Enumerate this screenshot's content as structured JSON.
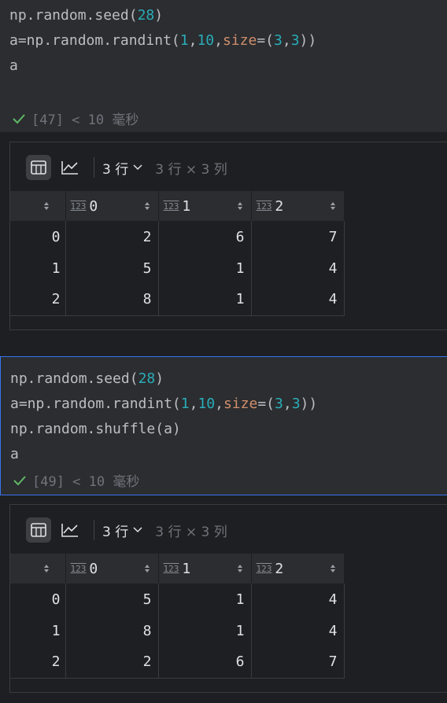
{
  "cell1": {
    "lines": [
      [
        {
          "t": "np.random.seed("
        },
        {
          "t": "28",
          "c": "num"
        },
        {
          "t": ")"
        }
      ],
      [
        {
          "t": "a=np.random.randint("
        },
        {
          "t": "1",
          "c": "num"
        },
        {
          "t": ","
        },
        {
          "t": "10",
          "c": "num"
        },
        {
          "t": ","
        },
        {
          "t": "size",
          "c": "kw"
        },
        {
          "t": "=("
        },
        {
          "t": "3",
          "c": "num"
        },
        {
          "t": ","
        },
        {
          "t": "3",
          "c": "num"
        },
        {
          "t": "))"
        }
      ],
      [
        {
          "t": "a"
        }
      ]
    ],
    "status": "[47] < 10 毫秒"
  },
  "output1": {
    "rows_label": "3 行",
    "shape_label": "3 行 × 3 列",
    "columns": [
      {
        "type": "123",
        "name": "0"
      },
      {
        "type": "123",
        "name": "1"
      },
      {
        "type": "123",
        "name": "2"
      }
    ],
    "rows": [
      [
        "0",
        "2",
        "6",
        "7"
      ],
      [
        "1",
        "5",
        "1",
        "4"
      ],
      [
        "2",
        "8",
        "1",
        "4"
      ]
    ]
  },
  "cell2": {
    "lines": [
      [
        {
          "t": "np.random.seed("
        },
        {
          "t": "28",
          "c": "num"
        },
        {
          "t": ")"
        }
      ],
      [
        {
          "t": "a=np.random.randint("
        },
        {
          "t": "1",
          "c": "num"
        },
        {
          "t": ","
        },
        {
          "t": "10",
          "c": "num"
        },
        {
          "t": ","
        },
        {
          "t": "size",
          "c": "kw"
        },
        {
          "t": "=("
        },
        {
          "t": "3",
          "c": "num"
        },
        {
          "t": ","
        },
        {
          "t": "3",
          "c": "num"
        },
        {
          "t": "))"
        }
      ],
      [
        {
          "t": "np.random.shuffle(a)"
        }
      ],
      [
        {
          "t": "a"
        }
      ]
    ],
    "status": "[49] < 10 毫秒"
  },
  "output2": {
    "rows_label": "3 行",
    "shape_label": "3 行 × 3 列",
    "columns": [
      {
        "type": "123",
        "name": "0"
      },
      {
        "type": "123",
        "name": "1"
      },
      {
        "type": "123",
        "name": "2"
      }
    ],
    "rows": [
      [
        "0",
        "5",
        "1",
        "4"
      ],
      [
        "1",
        "8",
        "1",
        "4"
      ],
      [
        "2",
        "2",
        "6",
        "7"
      ]
    ]
  }
}
